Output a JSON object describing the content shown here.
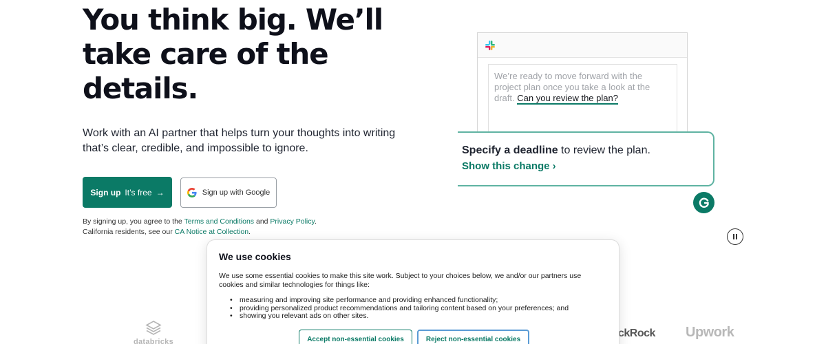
{
  "hero": {
    "title": "You think big. We’ll take care of the details.",
    "subtitle": "Work with an AI partner that helps turn your thoughts into writing that’s clear, credible, and impossible to ignore."
  },
  "signup": {
    "primary_bold": "Sign up",
    "primary_rest": "It’s free",
    "primary_arrow": "→",
    "google_label": "Sign up with Google"
  },
  "legal": {
    "line1_prefix": "By signing up, you agree to the ",
    "terms_link": "Terms and Conditions",
    "and": " and ",
    "privacy_link": "Privacy Policy",
    "period": ".",
    "line2_prefix": "California residents, see our ",
    "ca_link": "CA Notice at Collection",
    "period2": "."
  },
  "demo": {
    "message_plain": "We’re ready to move forward with the project plan once you take a look at the draft.",
    "message_highlight": "Can you review the plan?",
    "suggestion_bold": "Specify a deadline",
    "suggestion_rest": " to review the plan.",
    "suggestion_action": "Show this change ›"
  },
  "logos": {
    "databricks": "databricks",
    "blackrock": "ckRock",
    "upwork": "Upwork"
  },
  "cookie": {
    "title": "We use cookies",
    "body": "We use some essential cookies to make this site work. Subject to your choices below, we and/or our partners use cookies and similar technologies for things like:",
    "items": [
      "measuring and improving site performance and providing enhanced functionality;",
      "providing personalized product recommendations and tailoring content based on your preferences; and",
      "showing you relevant ads on other sites."
    ],
    "accept_label": "Accept non-essential cookies",
    "reject_label": "Reject non-essential cookies"
  },
  "colors": {
    "brand": "#0b7a66",
    "suggest_border": "#5fb3a2",
    "focus_ring": "#5a9bd5"
  },
  "icons": [
    "slack-icon",
    "google-icon",
    "grammarly-icon",
    "pause-icon",
    "databricks-icon"
  ]
}
